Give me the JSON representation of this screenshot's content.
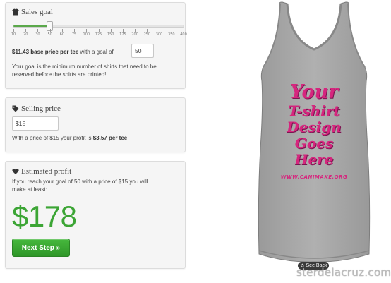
{
  "sales_goal": {
    "title": "Sales goal",
    "slider_fraction": 0.21,
    "ticks": [
      "10",
      "20",
      "30",
      "50",
      "60",
      "75",
      "100",
      "125",
      "150",
      "175",
      "200",
      "250",
      "300",
      "350",
      "400"
    ],
    "base_price": "$11.43 base price per tee",
    "goal_label": "with a goal of",
    "goal_value": "50",
    "help_line1": "Your goal is the minimum number of shirts that need to be",
    "help_line2": "reserved before the shirts are printed!"
  },
  "selling_price": {
    "title": "Selling price",
    "value": "$15",
    "profit_prefix": "With a price of $15 your profit is",
    "profit_value": "$3.57 per tee"
  },
  "estimated_profit": {
    "title": "Estimated profit",
    "line1": "If you reach your goal of 50 with a price of $15 you will",
    "line2": "make at least:",
    "amount": "$178",
    "next_button": "Next Step »"
  },
  "shirt": {
    "design_lines": [
      "Your",
      "T-shirt",
      "Design",
      "Goes",
      "Here"
    ],
    "design_url": "WWW.CANIMAKE.ORG",
    "see_back": "See Back"
  },
  "watermark": "sterdelacruz.com",
  "colors": {
    "accent_green": "#3ca535",
    "design_pink": "#d6267e",
    "shirt_gray": "#a9a9a9"
  },
  "icons": {
    "sales_goal": "shirt-icon",
    "selling_price": "tag-icon",
    "estimated_profit": "heart-icon",
    "see_back": "rotate-icon"
  }
}
